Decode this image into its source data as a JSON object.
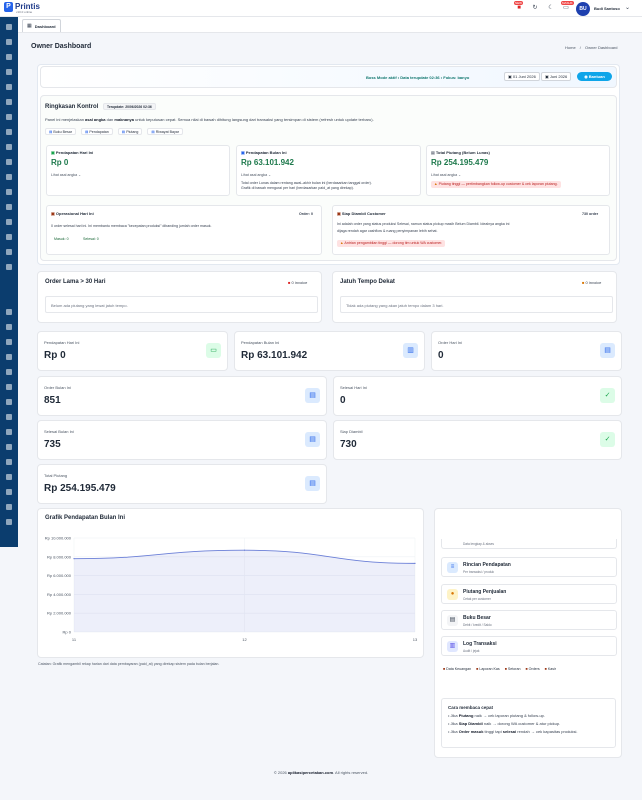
{
  "brand": {
    "name": "Printis",
    "version": "v10.0 online"
  },
  "topbar": {
    "badge_1": "NEW",
    "badge_2": "MASUK",
    "user_initials": "BU",
    "user_name": "Budi Santoso"
  },
  "tabbar": {
    "active_tab": "Dashboard"
  },
  "header": {
    "title": "Owner Dashboard",
    "crumb_home": "Home",
    "crumb_sep": "/",
    "crumb_current": "Owner Dashboard"
  },
  "modebar": {
    "status": "Boss Mode aktif • Data terupdate 02:36 • Fokus: banyo",
    "date_from": "01 Juni 2026",
    "date_to": "Juni 2026",
    "help_label": "Bantuan"
  },
  "ringkasan": {
    "title": "Ringkasan Kontrol",
    "updated": "Terupdate: 20/06/2026 02:36",
    "desc_a": "Panel ini menjelaskan ",
    "desc_b": "asal angka",
    "desc_c": " dan ",
    "desc_d": "maknanya",
    "desc_e": " untuk keputusan cepat. Semua nilai di bawah dihitung langsung dari transaksi yang tersimpan di sistem (refresh untuk update terbaru).",
    "links": [
      "Buku Besar",
      "Pendapatan",
      "Piutang",
      "Riwayat Bayar"
    ]
  },
  "cards": {
    "hari_ini": {
      "title": "Pendapatan Hari Ini",
      "value": "Rp 0",
      "link": "Lihat asal angka"
    },
    "bulan_ini": {
      "title": "Pendapatan Bulan Ini",
      "value": "Rp 63.101.942",
      "link": "Lihat asal angka",
      "note_1": "Total order Lunas dalam rentang awal–akhir bulan ini (berdasarkan tanggal order).",
      "note_2": "Grafik di bawah mengurai per hari (berdasarkan paid_at yang direkap)."
    },
    "piutang": {
      "title": "Total Piutang (Belum Lunas)",
      "value": "Rp 254.195.479",
      "link": "Lihat asal angka",
      "warn": "Piutang tinggi — pertimbangkan follow-up customer & cek laporan piutang."
    },
    "operasional": {
      "title": "Operasional Hari Ini",
      "badge": "Order: 0",
      "desc": "0 order selesai hari ini. Ini membantu membaca \"kecepatan produksi\" dibanding jumlah order masuk.",
      "masuk": "Masuk: 0",
      "selesai": "Selesai: 0"
    },
    "siap": {
      "title": "Siap Diambil Customer",
      "badge": "730 order",
      "desc_1": "Ini adalah order yang status produksi Selesai, namun status pickup masih Belum Diambil. Idealnya angka ini",
      "desc_2": "dijaga rendah agar cashflow & ruang penyimpanan lebih sehat.",
      "warn": "Antrian pengambilan tinggi — dorong tim untuk WA customer."
    }
  },
  "sections": {
    "lama": {
      "title": "Order Lama > 30 Hari",
      "badge": "0 invoice",
      "empty": "Belum ada piutang yang lewat jatuh tempo."
    },
    "tempo": {
      "title": "Jatuh Tempo Dekat",
      "badge": "0 invoice",
      "empty": "Tidak ada piutang yang akan jatuh tempo dalam 3 hari."
    }
  },
  "stats": [
    {
      "label": "Pendapatan Hari Ini",
      "value": "Rp 0",
      "icon": "cash-icon"
    },
    {
      "label": "Pendapatan Bulan Ini",
      "value": "Rp 63.101.942",
      "icon": "chart-icon"
    },
    {
      "label": "Order Hari Ini",
      "value": "0",
      "icon": "document-icon"
    },
    {
      "label": "Order Bulan Ini",
      "value": "851",
      "icon": "clipboard-icon"
    },
    {
      "label": "Selesai Hari Ini",
      "value": "0",
      "icon": "check-circle-icon"
    },
    {
      "label": "Selesai Bulan Ini",
      "value": "735",
      "icon": "clipboard-check-icon"
    },
    {
      "label": "Siap Diambil",
      "value": "730",
      "icon": "check-icon"
    },
    {
      "label": "Total Piutang",
      "value": "Rp 254.195.479",
      "icon": "receipt-icon"
    }
  ],
  "chart_data": {
    "type": "area",
    "title": "Grafik Pendapatan Bulan Ini",
    "xlabel": "",
    "ylabel": "",
    "x": [
      "11",
      "12",
      "13"
    ],
    "y_ticks": [
      "Rp 0",
      "Rp 2.000.000",
      "Rp 4.000.000",
      "Rp 6.000.000",
      "Rp 8.000.000",
      "Rp 10.000.000"
    ],
    "ylim": [
      0,
      10000000
    ],
    "series": [
      {
        "values": [
          7800000,
          8700000,
          7300000
        ]
      }
    ],
    "color": "#6b7fd7",
    "grid": true
  },
  "chart_caption": "Catatan: Grafik mengambil rekap harian dari data pembayaran (paid_at) yang direkap sistem pada bulan berjalan.",
  "quick_menu": {
    "partial_sub": "Data lengkap & akses",
    "items": [
      {
        "name": "Rincian Pendapatan",
        "sub": "Per transaksi / produk",
        "icon": "list-icon"
      },
      {
        "name": "Piutang Penjualan",
        "sub": "Cetak per customer",
        "icon": "coin-icon"
      },
      {
        "name": "Buku Besar",
        "sub": "Debit / kredit / Saldo",
        "icon": "book-icon"
      },
      {
        "name": "Log Transaksi",
        "sub": "Audit / jejak",
        "icon": "log-icon"
      }
    ],
    "chips": [
      "Data Keuangan",
      "Laporan Kas",
      "Setoran",
      "Orders",
      "Kasir"
    ]
  },
  "tips": {
    "title": "Cara membaca cepat",
    "t1a": "• Jika ",
    "t1b": "Piutang",
    "t1c": " naik → cek laporan piutang & follow-up.",
    "t2a": "• Jika ",
    "t2b": "Siap Diambil",
    "t2c": " naik → dorong WA customer & atur pickup.",
    "t3a": "• Jika ",
    "t3b": "Order masuk",
    "t3c": " tinggi tapi ",
    "t3d": "selesai",
    "t3e": " rendah → cek kapasitas produksi."
  },
  "footer": {
    "a": "© 2026 ",
    "b": "aplikasipercetakan.com",
    "c": ". All rights reserved."
  }
}
